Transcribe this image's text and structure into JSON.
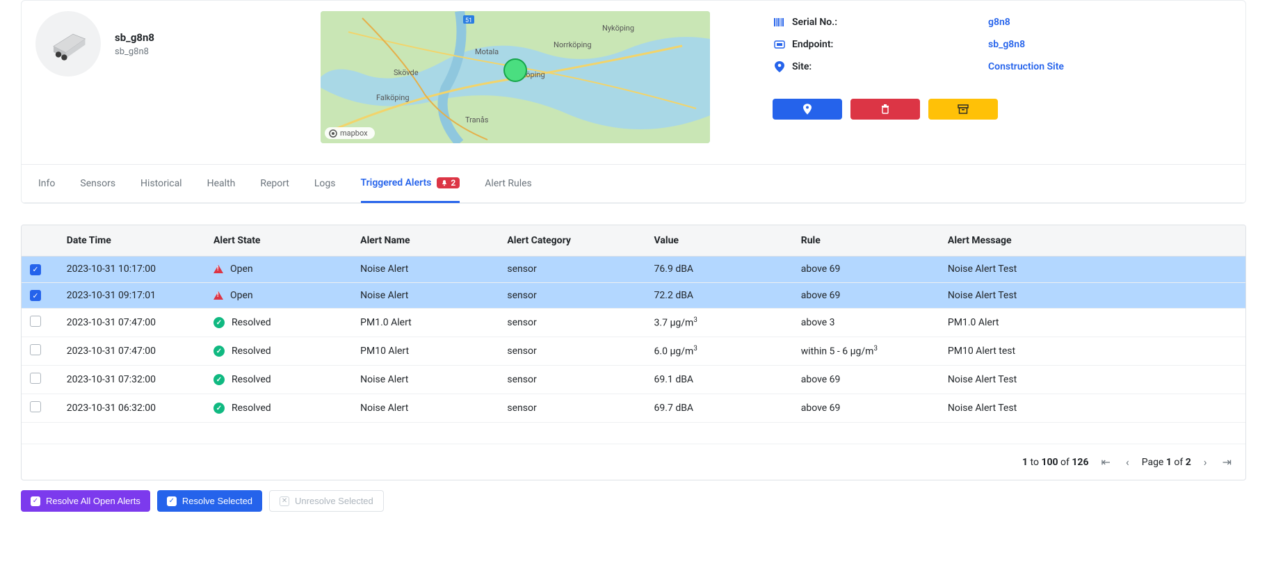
{
  "device": {
    "title": "sb_g8n8",
    "subtitle": "sb_g8n8"
  },
  "map": {
    "attribution": "mapbox",
    "road_label": "51",
    "cities": [
      "Nyköping",
      "Norrköping",
      "Linköping",
      "Motala",
      "Skövde",
      "Falköping",
      "Tranås"
    ]
  },
  "meta": {
    "serial_label": "Serial No.:",
    "serial_value": "g8n8",
    "endpoint_label": "Endpoint:",
    "endpoint_value": "sb_g8n8",
    "site_label": "Site:",
    "site_value": "Construction Site"
  },
  "tabs": {
    "items": [
      {
        "label": "Info"
      },
      {
        "label": "Sensors"
      },
      {
        "label": "Historical"
      },
      {
        "label": "Health"
      },
      {
        "label": "Report"
      },
      {
        "label": "Logs"
      },
      {
        "label": "Triggered Alerts",
        "active": true,
        "badge": "2"
      },
      {
        "label": "Alert Rules"
      }
    ]
  },
  "table": {
    "headers": {
      "date": "Date Time",
      "state": "Alert State",
      "name": "Alert Name",
      "category": "Alert Category",
      "value": "Value",
      "rule": "Rule",
      "message": "Alert Message"
    },
    "rows": [
      {
        "checked": true,
        "selected": true,
        "date": "2023-10-31 10:17:00",
        "state": "Open",
        "name": "Noise Alert",
        "category": "sensor",
        "value": "76.9 dBA",
        "rule": "above 69",
        "message": "Noise Alert Test"
      },
      {
        "checked": true,
        "selected": true,
        "date": "2023-10-31 09:17:01",
        "state": "Open",
        "name": "Noise Alert",
        "category": "sensor",
        "value": "72.2 dBA",
        "rule": "above 69",
        "message": "Noise Alert Test"
      },
      {
        "checked": false,
        "selected": false,
        "date": "2023-10-31 07:47:00",
        "state": "Resolved",
        "name": "PM1.0 Alert",
        "category": "sensor",
        "value_html": "3.7 µg/m<sup>3</sup>",
        "rule": "above 3",
        "message": "PM1.0 Alert"
      },
      {
        "checked": false,
        "selected": false,
        "date": "2023-10-31 07:47:00",
        "state": "Resolved",
        "name": "PM10 Alert",
        "category": "sensor",
        "value_html": "6.0 µg/m<sup>3</sup>",
        "rule_html": "within 5 - 6 µg/m<sup>3</sup>",
        "message": "PM10 Alert test"
      },
      {
        "checked": false,
        "selected": false,
        "date": "2023-10-31 07:32:00",
        "state": "Resolved",
        "name": "Noise Alert",
        "category": "sensor",
        "value": "69.1 dBA",
        "rule": "above 69",
        "message": "Noise Alert Test"
      },
      {
        "checked": false,
        "selected": false,
        "date": "2023-10-31 06:32:00",
        "state": "Resolved",
        "name": "Noise Alert",
        "category": "sensor",
        "value": "69.7 dBA",
        "rule": "above 69",
        "message": "Noise Alert Test"
      }
    ]
  },
  "pager": {
    "from": "1",
    "to": "100",
    "of_word": "of",
    "total": "126",
    "page_word": "Page",
    "page": "1",
    "of_word2": "of",
    "pages": "2",
    "to_word": "to"
  },
  "actions": {
    "resolve_all": "Resolve All Open Alerts",
    "resolve_selected": "Resolve Selected",
    "unresolve_selected": "Unresolve Selected"
  }
}
